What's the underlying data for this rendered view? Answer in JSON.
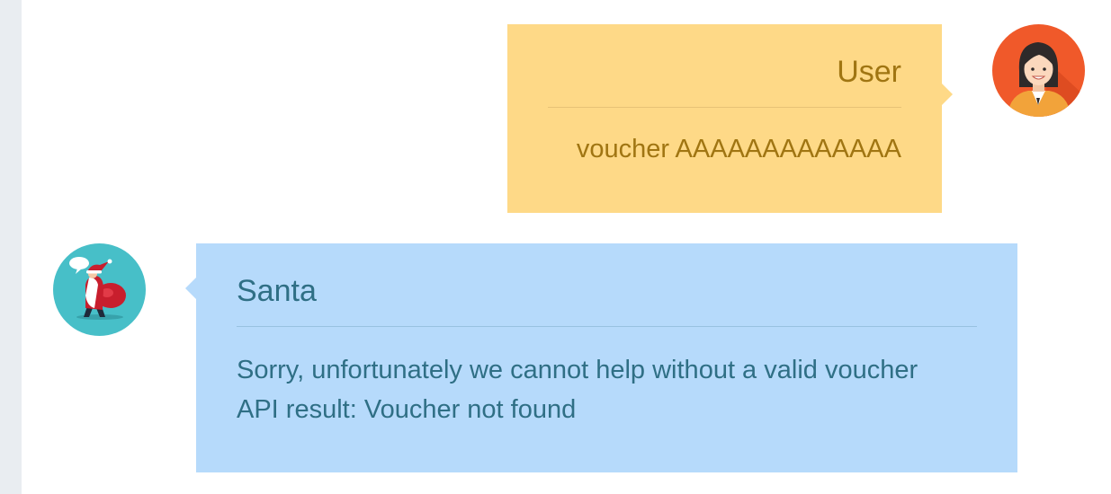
{
  "messages": [
    {
      "sender": "User",
      "side": "right",
      "avatar_icon": "user-avatar-icon",
      "lines": [
        "voucher AAAAAAAAAAAAA"
      ],
      "bubble_color": "#fed987",
      "text_color": "#a07512"
    },
    {
      "sender": "Santa",
      "side": "left",
      "avatar_icon": "santa-avatar-icon",
      "lines": [
        "Sorry, unfortunately we cannot help without a valid voucher",
        "API result: Voucher not found"
      ],
      "bubble_color": "#b6dafb",
      "text_color": "#2f6f85"
    }
  ],
  "colors": {
    "left_rail": "#e9edf1",
    "user_avatar_bg": "#f0592a",
    "santa_avatar_bg": "#47bfc8"
  }
}
